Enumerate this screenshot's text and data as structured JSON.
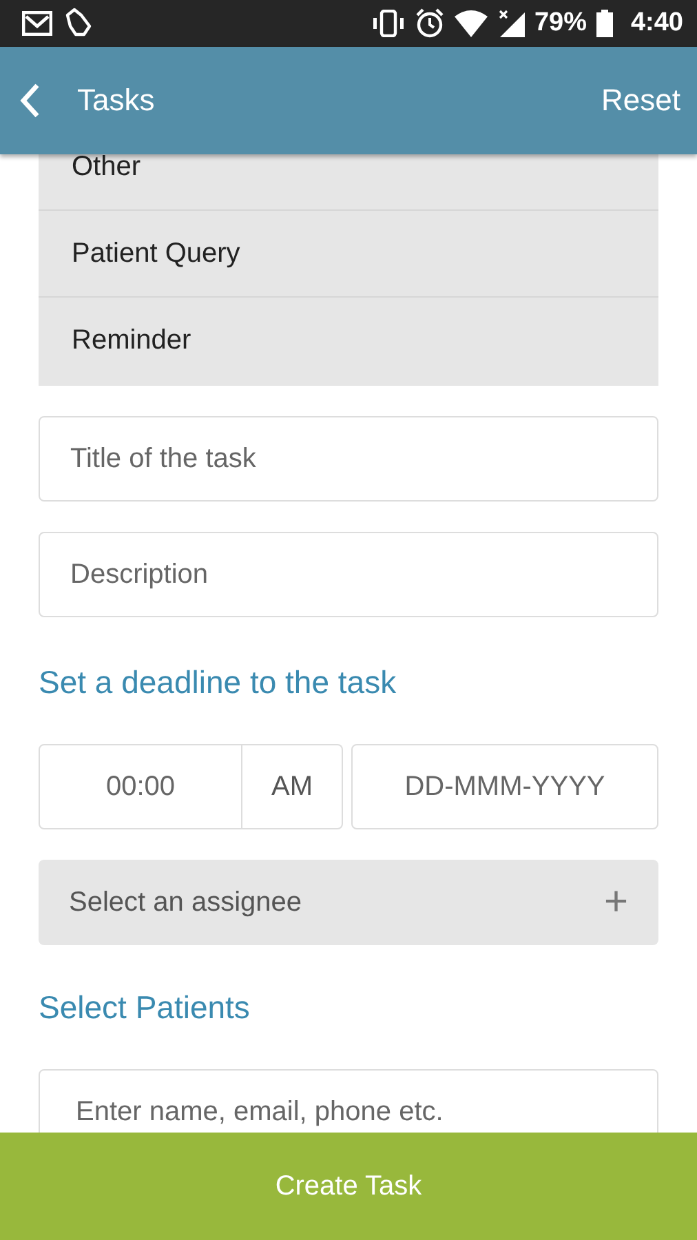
{
  "status_bar": {
    "battery": "79%",
    "time": "4:40"
  },
  "app_bar": {
    "title": "Tasks",
    "action": "Reset"
  },
  "task_types": [
    {
      "label": "Other"
    },
    {
      "label": "Patient Query"
    },
    {
      "label": "Reminder"
    }
  ],
  "title_field": {
    "placeholder": "Title of the task"
  },
  "description_field": {
    "placeholder": "Description"
  },
  "deadline_heading": "Set a deadline to the task",
  "deadline": {
    "time": {
      "placeholder": "00:00"
    },
    "meridiem": "AM",
    "date": {
      "placeholder": "DD-MMM-YYYY"
    }
  },
  "assignee": {
    "placeholder": "Select an assignee",
    "icon": "+"
  },
  "patients_heading": "Select Patients",
  "patient_field": {
    "placeholder": "Enter name, email, phone etc."
  },
  "submit": "Create Task"
}
